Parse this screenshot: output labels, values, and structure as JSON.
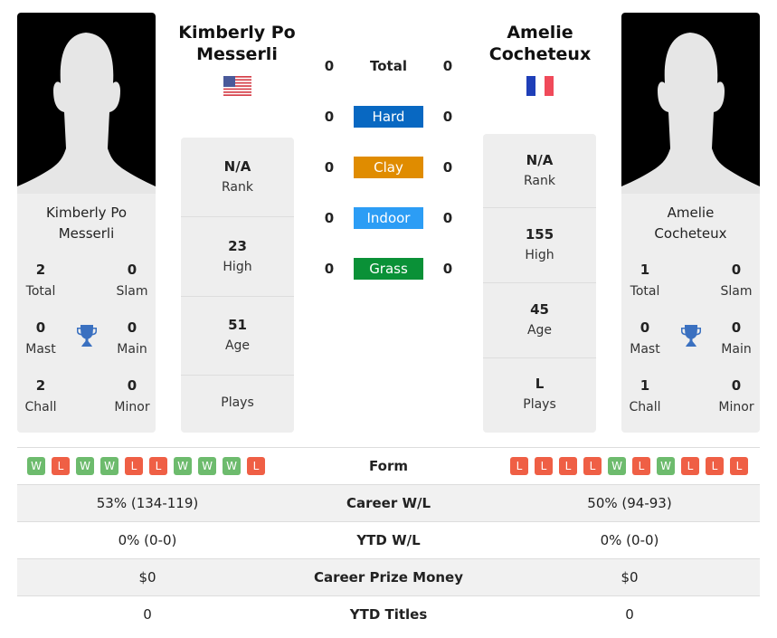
{
  "player1": {
    "name": "Kimberly Po Messerli",
    "name_line1": "Kimberly Po",
    "name_line2": "Messerli",
    "country": "USA",
    "titles": {
      "total": "2",
      "total_label": "Total",
      "slam": "0",
      "slam_label": "Slam",
      "mast": "0",
      "mast_label": "Mast",
      "main": "0",
      "main_label": "Main",
      "chall": "2",
      "chall_label": "Chall",
      "minor": "0",
      "minor_label": "Minor"
    },
    "stats": [
      {
        "value": "N/A",
        "label": "Rank"
      },
      {
        "value": "23",
        "label": "High"
      },
      {
        "value": "51",
        "label": "Age"
      },
      {
        "value": "",
        "label": "Plays"
      }
    ],
    "form": [
      "W",
      "L",
      "W",
      "W",
      "L",
      "L",
      "W",
      "W",
      "W",
      "L"
    ]
  },
  "player2": {
    "name": "Amelie Cocheteux",
    "name_line1": "Amelie",
    "name_line2": "Cocheteux",
    "country": "France",
    "titles": {
      "total": "1",
      "total_label": "Total",
      "slam": "0",
      "slam_label": "Slam",
      "mast": "0",
      "mast_label": "Mast",
      "main": "0",
      "main_label": "Main",
      "chall": "1",
      "chall_label": "Chall",
      "minor": "0",
      "minor_label": "Minor"
    },
    "stats": [
      {
        "value": "N/A",
        "label": "Rank"
      },
      {
        "value": "155",
        "label": "High"
      },
      {
        "value": "45",
        "label": "Age"
      },
      {
        "value": "L",
        "label": "Plays"
      }
    ],
    "form": [
      "L",
      "L",
      "L",
      "L",
      "W",
      "L",
      "W",
      "L",
      "L",
      "L"
    ]
  },
  "h2h": [
    {
      "label": "Total",
      "p1": "0",
      "p2": "0",
      "color": ""
    },
    {
      "label": "Hard",
      "p1": "0",
      "p2": "0",
      "color": "#0868c2"
    },
    {
      "label": "Clay",
      "p1": "0",
      "p2": "0",
      "color": "#e08c00"
    },
    {
      "label": "Indoor",
      "p1": "0",
      "p2": "0",
      "color": "#2c9df5"
    },
    {
      "label": "Grass",
      "p1": "0",
      "p2": "0",
      "color": "#0a9137"
    }
  ],
  "table": {
    "form_label": "Form",
    "rows": [
      {
        "label": "Career W/L",
        "p1": "53% (134-119)",
        "p2": "50% (94-93)"
      },
      {
        "label": "YTD W/L",
        "p1": "0% (0-0)",
        "p2": "0% (0-0)"
      },
      {
        "label": "Career Prize Money",
        "p1": "$0",
        "p2": "$0"
      },
      {
        "label": "YTD Titles",
        "p1": "0",
        "p2": "0"
      }
    ]
  },
  "colors": {
    "win": "#6dbb6d",
    "loss": "#ef5f45",
    "trophy": "#3a70c0"
  }
}
